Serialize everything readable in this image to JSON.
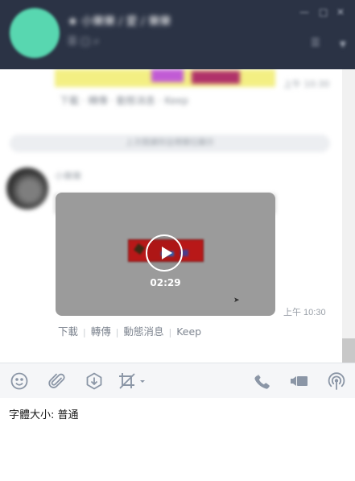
{
  "header": {
    "title": "★ 小樂樂 / 愛 / 樂樂",
    "subtitle": "☰ ▢ ⌕"
  },
  "chat": {
    "top_message": {
      "time": "上午 10:30",
      "actions": "下載 · 轉傳 · 動態消息 · Keep"
    },
    "date_divider": "上次閱讀到這裡欄位顯示",
    "video_message": {
      "sender": "小樂樂",
      "duration": "02:29",
      "time": "上午 10:30",
      "actions": {
        "download": "下載",
        "forward": "轉傳",
        "timeline": "動態消息",
        "keep": "Keep"
      }
    }
  },
  "toolbar": {
    "left": [
      "emoji-icon",
      "attachment-icon",
      "save-download-icon",
      "crop-screenshot-icon"
    ],
    "right": [
      "phone-icon",
      "video-call-icon",
      "broadcast-icon"
    ],
    "icon_color": "#8b96a6"
  },
  "input": {
    "text": "字體大小: 普通"
  },
  "colors": {
    "header_bg": "#2b3345",
    "chat_bg": "#ffffff",
    "toolbar_bg": "#f5f6f8",
    "avatar": "#58d7b0"
  }
}
